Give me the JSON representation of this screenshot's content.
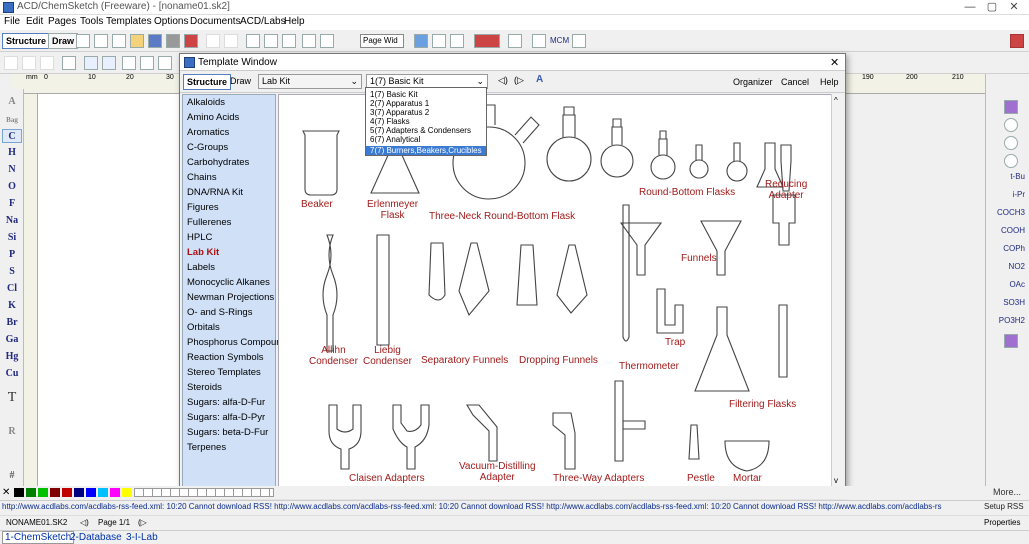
{
  "app": {
    "title": "ACD/ChemSketch (Freeware) - [noname01.sk2]",
    "minimize": "—",
    "maximize": "▢",
    "close": "✕"
  },
  "menu": [
    "File",
    "Edit",
    "Pages",
    "Tools",
    "Templates",
    "Options",
    "Documents",
    "ACD/Labs",
    "Help"
  ],
  "toolbar": {
    "structure": "Structure",
    "draw": "Draw",
    "zoom_value": "Page Wid",
    "mcm": "MCM"
  },
  "ruler": {
    "unit": "mm",
    "ticks": [
      "0",
      "10",
      "20",
      "30",
      "190",
      "200",
      "210"
    ]
  },
  "left_palette": [
    "A",
    "Bag",
    "C",
    "H",
    "N",
    "O",
    "F",
    "Na",
    "Si",
    "P",
    "S",
    "Cl",
    "K",
    "Br",
    "Ga",
    "Hg",
    "Cu",
    "T",
    "R",
    "#"
  ],
  "right_palette": [
    "t-Bu",
    "i-Pr",
    "COCH3",
    "COOH",
    "COPh",
    "NO2",
    "OAc",
    "SO3H",
    "PO3H2"
  ],
  "template_window": {
    "title": "Template Window",
    "close": "✕",
    "structure": "Structure",
    "draw": "Draw",
    "kit_select": "Lab Kit",
    "page_select": "1(7) Basic Kit",
    "organizer": "Organizer",
    "cancel": "Cancel",
    "help": "Help",
    "categories": [
      "Alkaloids",
      "Amino Acids",
      "Aromatics",
      "C-Groups",
      "Carbohydrates",
      "Chains",
      "DNA/RNA Kit",
      "Figures",
      "Fullerenes",
      "HPLC",
      "Lab Kit",
      "Labels",
      "Monocyclic Alkanes",
      "Newman Projections",
      "O- and S-Rings",
      "Orbitals",
      "Phosphorus Compoun",
      "Reaction Symbols",
      "Stereo Templates",
      "Steroids",
      "Sugars: alfa-D-Fur",
      "Sugars: alfa-D-Pyr",
      "Sugars: beta-D-Fur",
      "Terpenes"
    ],
    "selected_category": "Lab Kit",
    "dropdown_options": [
      "1(7) Basic Kit",
      "2(7) Apparatus 1",
      "3(7) Apparatus 2",
      "4(7) Flasks",
      "5(7) Adapters & Condensers",
      "6(7) Analytical",
      "7(7) Burners,Beakers,Crucibles"
    ],
    "dropdown_selected": "7(7) Burners,Beakers,Crucibles",
    "labels": {
      "beaker": "Beaker",
      "erlenmeyer": "Erlenmeyer\nFlask",
      "three_neck": "Three-Neck Round-Bottom Flask",
      "round_bottom": "Round-Bottom Flasks",
      "reducing": "Reducing\nAdapter",
      "funnels": "Funnels",
      "allihn": "Allihn\nCondenser",
      "liebig": "Liebig\nCondenser",
      "separatory": "Separatory Funnels",
      "dropping": "Dropping Funnels",
      "thermometer": "Thermometer",
      "trap": "Trap",
      "filtering": "Filtering Flasks",
      "claisen": "Claisen Adapters",
      "vacuum": "Vacuum-Distilling\nAdapter",
      "three_way": "Three-Way Adapters",
      "pestle": "Pestle",
      "mortar": "Mortar"
    }
  },
  "status": {
    "rss": "http://www.acdlabs.com/acdlabs-rss-feed.xml: 10:20 Cannot download RSS! http://www.acdlabs.com/acdlabs-rss-feed.xml: 10:20 Cannot download RSS! http://www.acdlabs.com/acdlabs-rss-feed.xml: 10:20 Cannot download RSS! http://www.acdlabs.com/acdlabs-rs",
    "setup_rss": "Setup RSS",
    "filename": "NONAME01.SK2",
    "page": "Page 1/1",
    "properties": "Properties",
    "more": "More..."
  },
  "bottom_tabs": [
    "1-ChemSketch",
    "2-Database",
    "3-I-Lab"
  ],
  "colors": {
    "accent": "#3b7bd4",
    "label_red": "#a21b1b",
    "list_bg": "#cfe0f7"
  }
}
